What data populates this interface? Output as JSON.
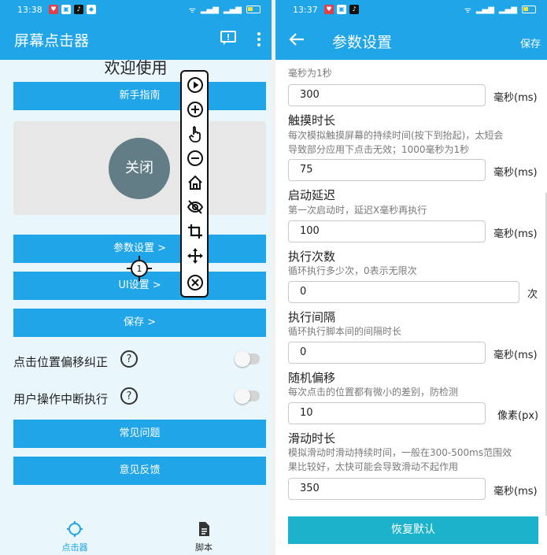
{
  "left": {
    "status": {
      "time": "13:38"
    },
    "appbar": {
      "title": "屏幕点击器"
    },
    "welcome": "欢迎使用",
    "buttons": {
      "guide": "新手指南",
      "params": "参数设置 >",
      "ui": "UI设置 >",
      "save": "保存 >",
      "faq": "常见问题",
      "feedback": "意见反馈"
    },
    "close_label": "关闭",
    "crosshair_label": "1",
    "switches": [
      {
        "label": "点击位置偏移纠正",
        "help": "?",
        "on": false
      },
      {
        "label": "用户操作中断执行",
        "help": "?",
        "on": false
      }
    ],
    "float_toolbar": [
      "play-icon",
      "add-icon",
      "pointer-icon",
      "remove-icon",
      "home-icon",
      "hide-icon",
      "crop-icon",
      "move-icon",
      "close-icon"
    ],
    "nav": [
      {
        "label": "点击器",
        "icon": "crosshair-icon",
        "active": true
      },
      {
        "label": "脚本",
        "icon": "script-icon",
        "active": false
      }
    ]
  },
  "right": {
    "status": {
      "time": "13:37"
    },
    "appbar": {
      "title": "参数设置",
      "save": "保存"
    },
    "top_desc": "毫秒为1秒",
    "top_value": "300",
    "top_unit": "毫秒(ms)",
    "sections": [
      {
        "title": "触摸时长",
        "desc1": "每次模拟触摸屏幕的持续时间(按下到抬起)，太短会",
        "desc2": "导致部分应用下点击无效；1000毫秒为1秒",
        "value": "75",
        "unit": "毫秒(ms)"
      },
      {
        "title": "启动延迟",
        "desc1": "第一次启动时，延迟X毫秒再执行",
        "desc2": "",
        "value": "100",
        "unit": "毫秒(ms)"
      },
      {
        "title": "执行次数",
        "desc1": "循环执行多少次，0表示无限次",
        "desc2": "",
        "value": "0",
        "unit": "次"
      },
      {
        "title": "执行间隔",
        "desc1": "循环执行脚本间的间隔时长",
        "desc2": "",
        "value": "0",
        "unit": "毫秒(ms)"
      },
      {
        "title": "随机偏移",
        "desc1": "每次点击的位置都有微小的差别，防检测",
        "desc2": "",
        "value": "10",
        "unit": "像素(px)"
      },
      {
        "title": "滑动时长",
        "desc1": "模拟滑动时滑动持续时间，一般在300-500ms范围效",
        "desc2": "果比较好，太快可能会导致滑动不起作用",
        "value": "350",
        "unit": "毫秒(ms)"
      }
    ],
    "restore": "恢复默认"
  },
  "colors": {
    "primary": "#1fa5e8",
    "restore": "#1bb3cc",
    "close_circle": "#627d85",
    "card": "#e7e7e7",
    "left_bg": "#e9f6fc"
  }
}
